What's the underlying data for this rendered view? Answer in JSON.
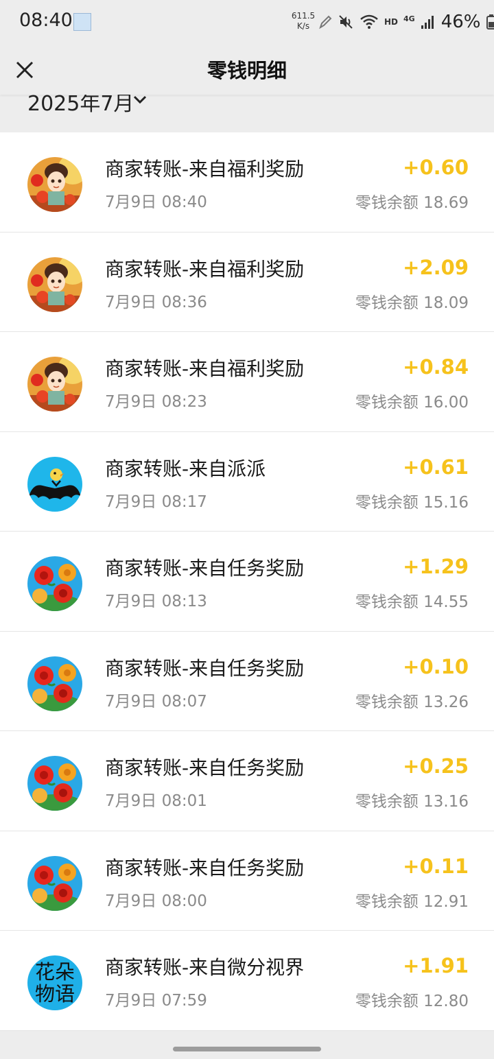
{
  "status_bar": {
    "time": "08:40",
    "net_speed_value": "611.5",
    "net_speed_unit": "K/s",
    "network_label": "HD",
    "signal_label": "4G",
    "battery": "46%"
  },
  "nav": {
    "title": "零钱明细",
    "close_icon": "close-icon"
  },
  "filter": {
    "month": "2025年7月",
    "chevron_icon": "chevron-down-icon"
  },
  "colors": {
    "amount": "#f6c21c",
    "background": "#ededed",
    "card": "#ffffff"
  },
  "transactions": [
    {
      "title": "商家转账-来自福利奖励",
      "time": "7月9日 08:40",
      "amount": "+0.60",
      "balance": "零钱余额 18.69",
      "avatar": "cartoon-girl-avatar"
    },
    {
      "title": "商家转账-来自福利奖励",
      "time": "7月9日 08:36",
      "amount": "+2.09",
      "balance": "零钱余额 18.09",
      "avatar": "cartoon-girl-avatar"
    },
    {
      "title": "商家转账-来自福利奖励",
      "time": "7月9日 08:23",
      "amount": "+0.84",
      "balance": "零钱余额 16.00",
      "avatar": "cartoon-girl-avatar"
    },
    {
      "title": "商家转账-来自派派",
      "time": "7月9日 08:17",
      "amount": "+0.61",
      "balance": "零钱余额 15.16",
      "avatar": "paipai-avatar"
    },
    {
      "title": "商家转账-来自任务奖励",
      "time": "7月9日 08:13",
      "amount": "+1.29",
      "balance": "零钱余额 14.55",
      "avatar": "flowers-avatar"
    },
    {
      "title": "商家转账-来自任务奖励",
      "time": "7月9日 08:07",
      "amount": "+0.10",
      "balance": "零钱余额 13.26",
      "avatar": "flowers-avatar"
    },
    {
      "title": "商家转账-来自任务奖励",
      "time": "7月9日 08:01",
      "amount": "+0.25",
      "balance": "零钱余额 13.16",
      "avatar": "flowers-avatar"
    },
    {
      "title": "商家转账-来自任务奖励",
      "time": "7月9日 08:00",
      "amount": "+0.11",
      "balance": "零钱余额 12.91",
      "avatar": "flowers-avatar"
    },
    {
      "title": "商家转账-来自微分视界",
      "time": "7月9日 07:59",
      "amount": "+1.91",
      "balance": "零钱余额 12.80",
      "avatar": "text-avatar",
      "avatar_text_1": "花朵",
      "avatar_text_2": "物语"
    }
  ]
}
